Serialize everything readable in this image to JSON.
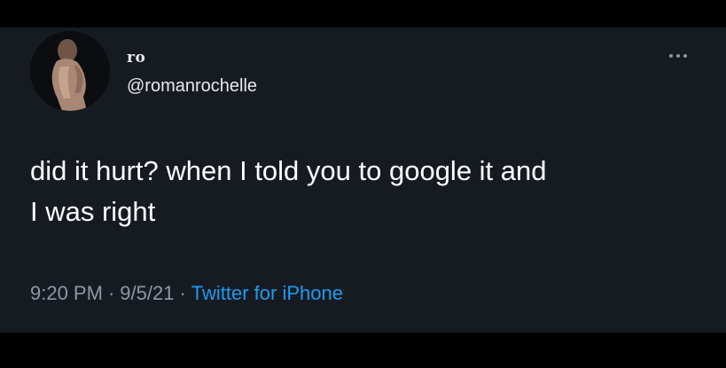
{
  "tweet": {
    "display_name": "ro",
    "handle": "@romanrochelle",
    "text": "did it hurt? when I told you to google it and\nI was right",
    "time": "9:20 PM",
    "date": "9/5/21",
    "separator": "·",
    "source": "Twitter for iPhone"
  },
  "icons": {
    "more": "more-options-icon",
    "avatar": "profile-photo"
  },
  "colors": {
    "background": "#161b22",
    "text_primary": "#ffffff",
    "text_secondary": "#8b98a5",
    "link": "#1d9bf0"
  }
}
